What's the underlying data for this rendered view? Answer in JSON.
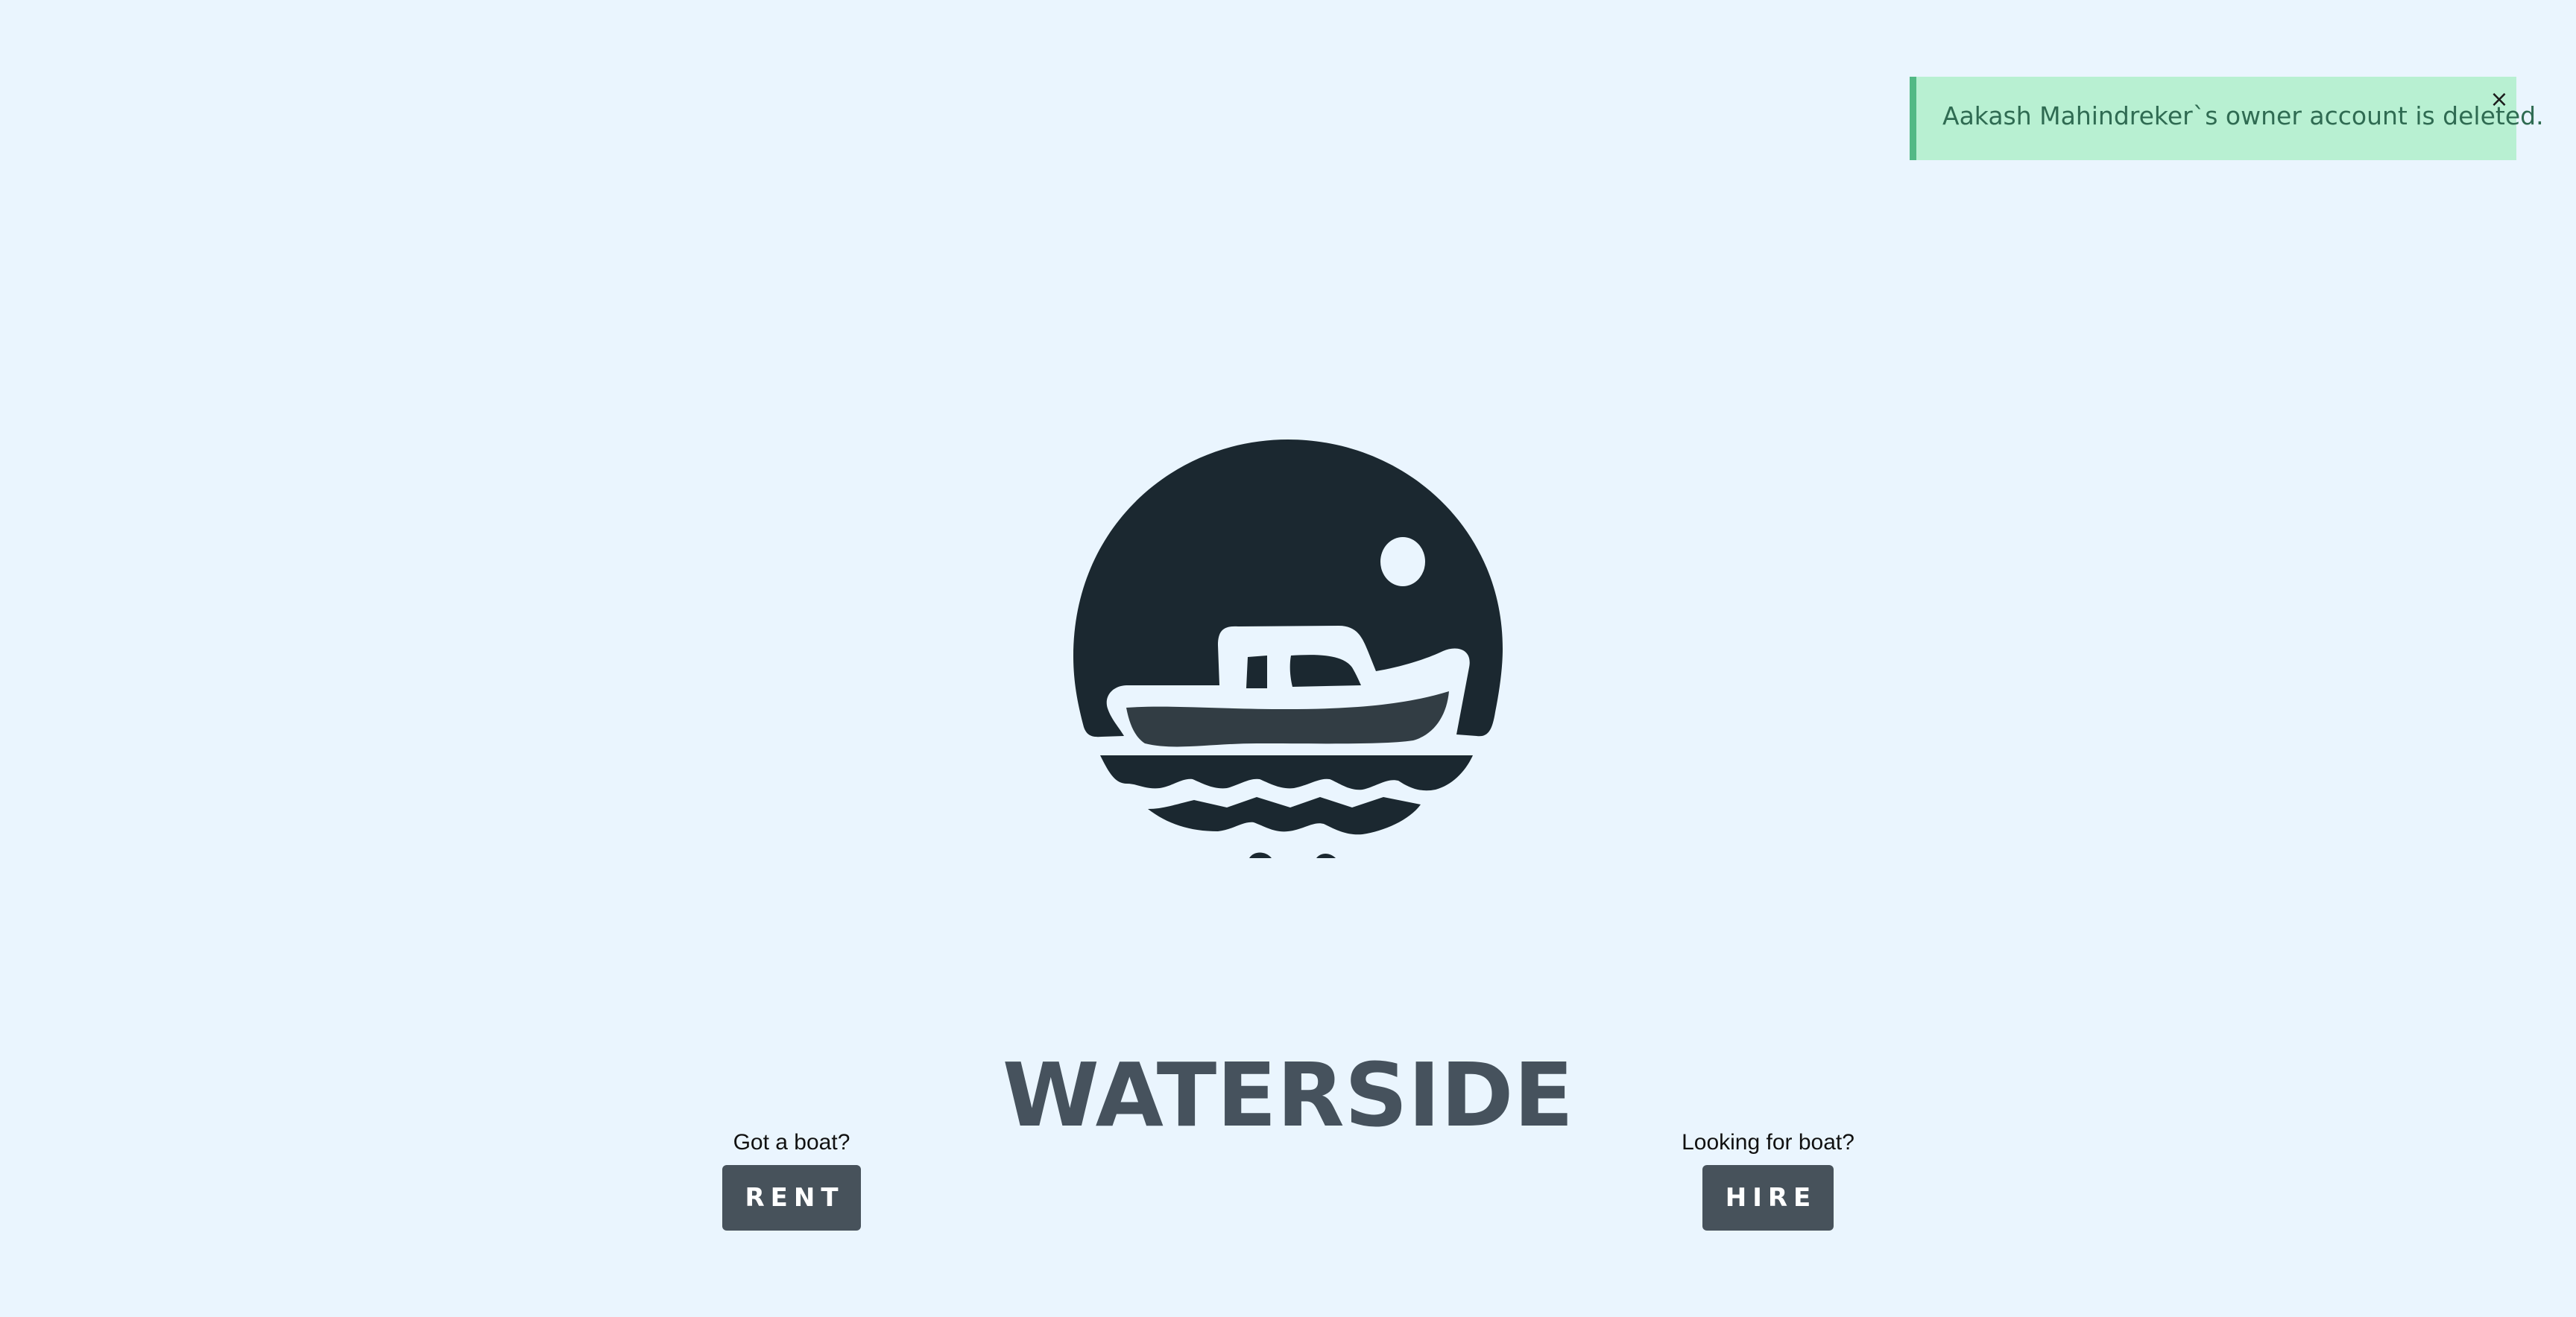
{
  "toast": {
    "message": "Aakash Mahindreker`s owner account is deleted.",
    "close_label": "×"
  },
  "brand": {
    "name": "WATERSIDE"
  },
  "cta": {
    "rent": {
      "label": "Got a boat?",
      "button": "RENT"
    },
    "hire": {
      "label": "Looking for boat?",
      "button": "HIRE"
    }
  },
  "icons": {
    "logo": "boat-sunset-logo",
    "close": "close-icon"
  },
  "colors": {
    "background": "#eaf5fe",
    "toast_bg": "#b8f0d2",
    "toast_accent": "#52b985",
    "toast_text": "#2f6b52",
    "logo_dark": "#1b2830",
    "brand_text": "#46525d",
    "button_bg": "#47525b"
  }
}
